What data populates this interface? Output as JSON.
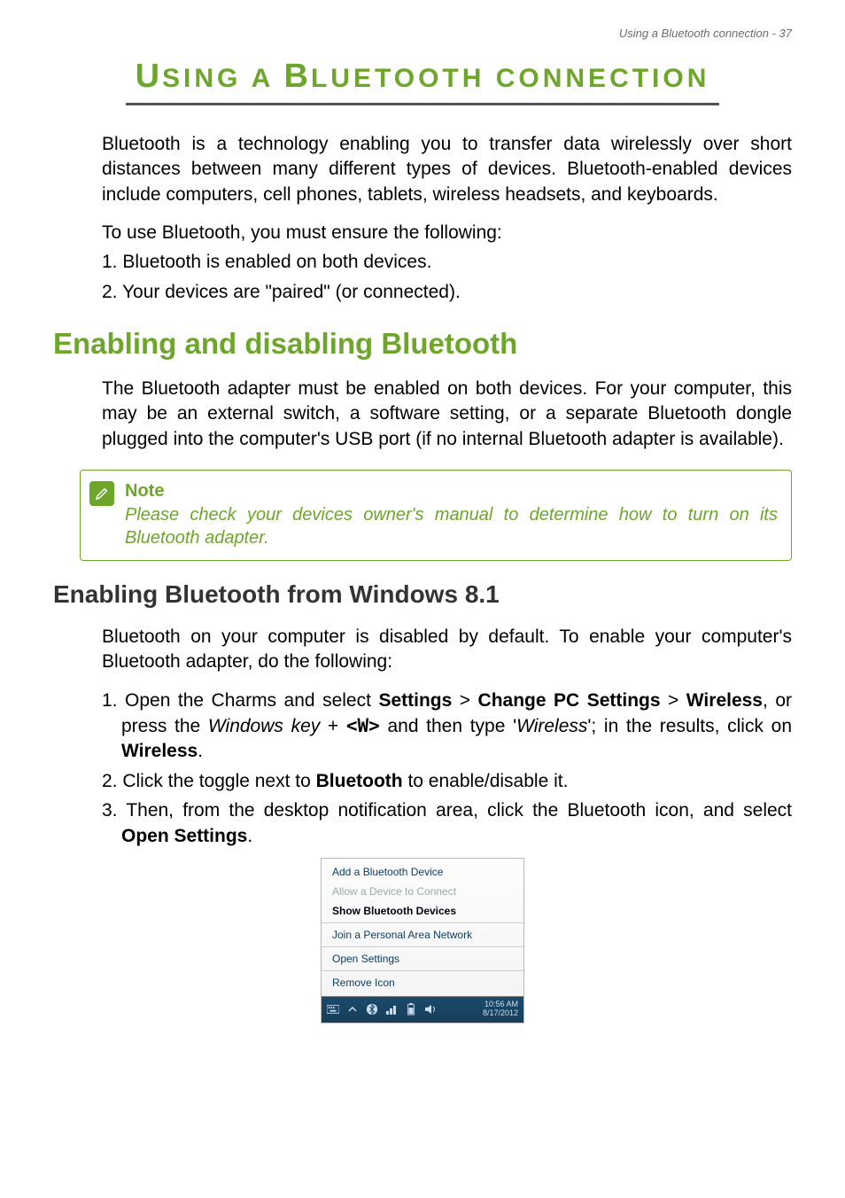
{
  "header": "Using a Bluetooth connection - 37",
  "title_cap1": "U",
  "title_small1": "SING A ",
  "title_cap2": "B",
  "title_small2": "LUETOOTH CONNECTION",
  "intro": "Bluetooth is a technology enabling you to transfer data wirelessly over short distances between many different types of devices. Bluetooth-enabled devices include computers, cell phones, tablets, wireless headsets, and keyboards.",
  "ensure_line": "To use Bluetooth, you must ensure the following:",
  "ensure_1": "1. Bluetooth is enabled on both devices.",
  "ensure_2": "2. Your devices are \"paired\" (or connected).",
  "h1": "Enabling and disabling Bluetooth",
  "h1_body": "The Bluetooth adapter must be enabled on both devices. For your computer, this may be an external switch, a software setting, or a separate Bluetooth dongle plugged into the computer's USB port (if no internal Bluetooth adapter is available).",
  "note_title": "Note",
  "note_body": "Please check your devices owner's manual to determine how to turn on its Bluetooth adapter.",
  "h2": "Enabling Bluetooth from Windows 8.1",
  "h2_intro": "Bluetooth on your computer is disabled by default. To enable your computer's Bluetooth adapter, do the following:",
  "step1_a": "1. Open the Charms and select ",
  "step1_settings": "Settings",
  "step1_gt1": " > ",
  "step1_change": "Change PC Settings",
  "step1_gt2": " > ",
  "step1_wireless": "Wireless",
  "step1_b": ", or press the ",
  "step1_winkey": "Windows key",
  "step1_plus": " + ",
  "step1_w": "<W>",
  "step1_c": " and then type '",
  "step1_wireless_it": "Wireless",
  "step1_d": "'; in the results, click on ",
  "step1_wireless_bold": "Wireless",
  "step1_e": ".",
  "step2_a": "2. Click the toggle next to ",
  "step2_bt": "Bluetooth",
  "step2_b": " to enable/disable it.",
  "step3_a": "3. Then, from the desktop notification area, click the Bluetooth icon, and select ",
  "step3_open": "Open Settings",
  "step3_b": ".",
  "menu": {
    "add": "Add a Bluetooth Device",
    "allow": "Allow a Device to Connect",
    "show": "Show Bluetooth Devices",
    "join": "Join a Personal Area Network",
    "open": "Open Settings",
    "remove": "Remove Icon"
  },
  "clock": {
    "time": "10:56 AM",
    "date": "8/17/2012"
  }
}
